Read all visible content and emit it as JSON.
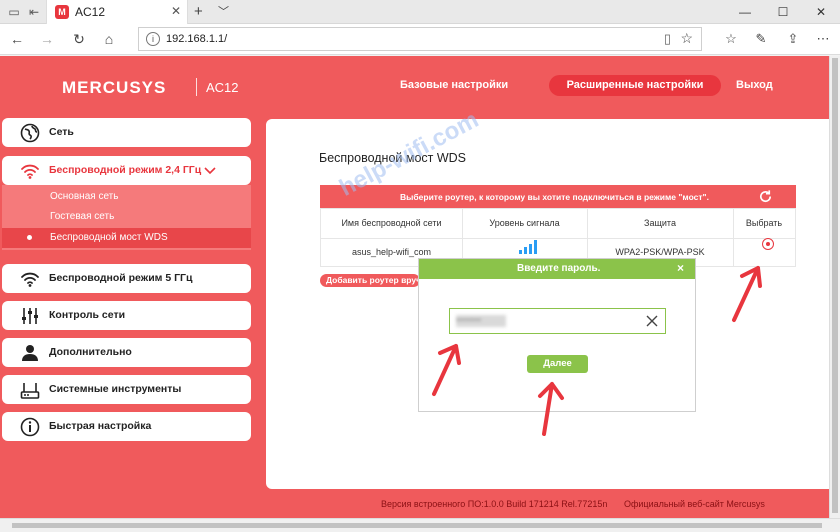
{
  "browser": {
    "tab_title": "AC12",
    "tab_favicon_letter": "M",
    "url": "192.168.1.1/",
    "icons": [
      "tab-preview-icon",
      "back-tab-icon",
      "close-icon",
      "new-tab-icon",
      "chevron-down-icon",
      "back-icon",
      "forward-icon",
      "reload-icon",
      "home-icon",
      "info-icon",
      "reading-view-icon",
      "star-icon",
      "favorites-icon",
      "pen-icon",
      "share-icon",
      "more-icon",
      "minimize-icon",
      "maximize-icon",
      "window-close-icon"
    ]
  },
  "header": {
    "logo": "MERCUSYS",
    "model": "AC12",
    "nav_basic": "Базовые настройки",
    "nav_advanced": "Расширенные настройки",
    "nav_logout": "Выход"
  },
  "sidebar": {
    "items": [
      {
        "label": "Сеть",
        "icon": "globe-icon"
      },
      {
        "label": "Беспроводной режим 2,4 ГГц",
        "icon": "wifi-icon",
        "active": true
      },
      {
        "label": "Беспроводной режим 5 ГГц",
        "icon": "wifi-icon"
      },
      {
        "label": "Контроль сети",
        "icon": "sliders-icon"
      },
      {
        "label": "Дополнительно",
        "icon": "user-icon"
      },
      {
        "label": "Системные инструменты",
        "icon": "router-icon"
      },
      {
        "label": "Быстрая настройка",
        "icon": "info-icon"
      }
    ],
    "sub_items": [
      {
        "label": "Основная сеть"
      },
      {
        "label": "Гостевая сеть"
      },
      {
        "label": "Беспроводной мост WDS",
        "selected": true
      }
    ]
  },
  "content": {
    "title": "Беспроводной мост WDS",
    "banner": "Выберите роутер, к которому вы хотите подключиться в режиме \"мост\".",
    "table": {
      "headers": [
        "Имя беспроводной сети",
        "Уровень сигнала",
        "Защита",
        "Выбрать"
      ],
      "rows": [
        {
          "ssid": "asus_help-wifi_com",
          "signal_bars": 4,
          "security": "WPA2-PSK/WPA-PSK",
          "selected": true
        }
      ]
    },
    "add_button": "Добавить роутер вручную"
  },
  "watermark": "help-wifi.com",
  "dialog": {
    "title": "Введите пароль.",
    "close": "×",
    "password_value": "••••••••",
    "next_button": "Далее"
  },
  "footer": {
    "firmware": "Версия встроенного ПО:1.0.0 Build 171214 Rel.77215n",
    "site_link": "Официальный веб-сайт Mercusys"
  },
  "colors": {
    "brand_red": "#f05a5c",
    "accent_red": "#e8363e",
    "dialog_green": "#8bc34a"
  }
}
